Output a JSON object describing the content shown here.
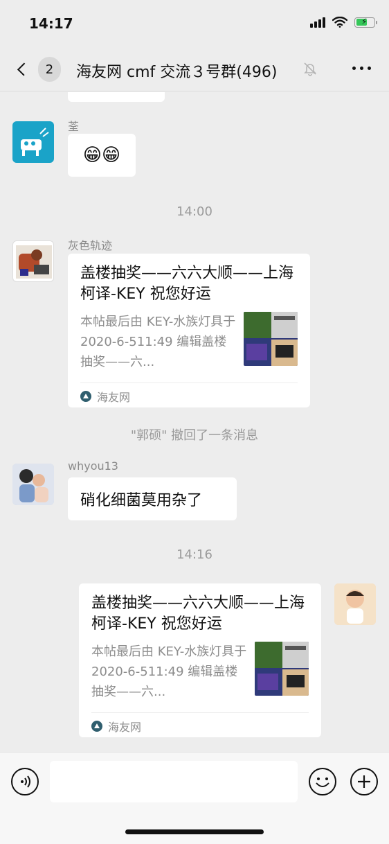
{
  "status_bar": {
    "time": "14:17"
  },
  "nav": {
    "unread_count": "2",
    "title": "海友网 cmf 交流３号群(496)"
  },
  "messages": {
    "m1": {
      "sender": "荃",
      "text": "😁😁"
    },
    "t1": "14:00",
    "m2": {
      "sender": "灰色轨迹",
      "card_title": "盖楼抽奖——六六大顺——上海柯译-KEY 祝您好运",
      "card_desc": "本帖最后由 KEY-水族灯具于 2020-6-511:49 编辑盖楼抽奖——六...",
      "source": "海友网"
    },
    "recall": "\"郭硕\" 撤回了一条消息",
    "m3": {
      "sender": "whyou13",
      "text": "硝化细菌莫用杂了"
    },
    "t2": "14:16",
    "m4": {
      "card_title": "盖楼抽奖——六六大顺——上海柯译-KEY 祝您好运",
      "card_desc": "本帖最后由 KEY-水族灯具于 2020-6-511:49 编辑盖楼抽奖——六...",
      "source": "海友网"
    }
  },
  "icons": {
    "back": "chevron-left-icon",
    "mute": "bell-slash-icon",
    "more": "ellipsis-icon",
    "voice": "voice-icon",
    "emoji": "smiley-icon",
    "plus": "plus-icon"
  },
  "colors": {
    "background": "#ededed",
    "bubble": "#ffffff",
    "meta_text": "#9a9a9a"
  }
}
